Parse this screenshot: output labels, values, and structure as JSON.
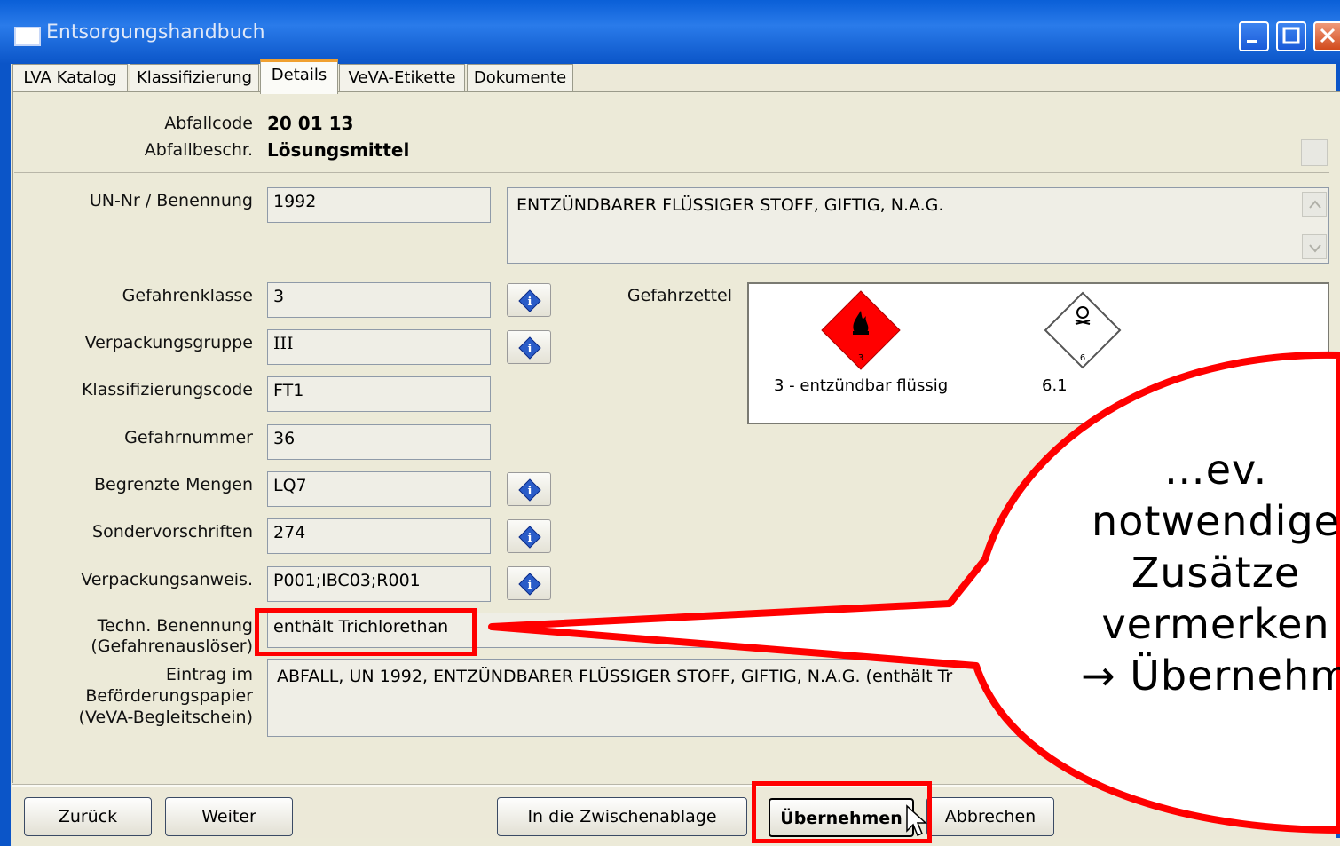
{
  "window": {
    "title": "Entsorgungshandbuch"
  },
  "tabs": [
    "LVA Katalog",
    "Klassifizierung",
    "Details",
    "VeVA-Etikette",
    "Dokumente"
  ],
  "active_tab": "Details",
  "header": {
    "abfallcode_label": "Abfallcode",
    "abfallcode_value": "20 01 13",
    "abfallbeschr_label": "Abfallbeschr.",
    "abfallbeschr_value": "Lösungsmittel"
  },
  "fields": {
    "un_label": "UN-Nr / Benennung",
    "un_nr": "1992",
    "benennung": "ENTZÜNDBARER FLÜSSIGER STOFF, GIFTIG, N.A.G.",
    "gefahrenklasse_label": "Gefahrenklasse",
    "gefahrenklasse": "3",
    "verpackungsgruppe_label": "Verpackungsgruppe",
    "verpackungsgruppe": "III",
    "klassifizierungscode_label": "Klassifizierungscode",
    "klassifizierungscode": "FT1",
    "gefahrnummer_label": "Gefahrnummer",
    "gefahrnummer": "36",
    "begrenzte_mengen_label": "Begrenzte Mengen",
    "begrenzte_mengen": "LQ7",
    "sondervorschriften_label": "Sondervorschriften",
    "sondervorschriften": "274",
    "verpackungsanweis_label": "Verpackungsanweis.",
    "verpackungsanweis": "P001;IBC03;R001",
    "techn_label_1": "Techn. Benennung",
    "techn_label_2": "(Gefahrenauslöser)",
    "techn_benennung": "enthält Trichlorethan",
    "eintrag_label_1": "Eintrag im",
    "eintrag_label_2": "Beförderungspapier",
    "eintrag_label_3": "(VeVA-Begleitschein)",
    "eintrag": "ABFALL, UN 1992, ENTZÜNDBARER FLÜSSIGER STOFF, GIFTIG, N.A.G. (enthält Tr"
  },
  "gefahrzettel": {
    "label": "Gefahrzettel",
    "items": [
      {
        "caption": "3 - entzündbar flüssig",
        "number": "3",
        "color": "#ff0000"
      },
      {
        "caption": "6.1",
        "number": "6",
        "color": "#ffffff"
      }
    ]
  },
  "buttons": {
    "zurueck": "Zurück",
    "weiter": "Weiter",
    "zwischenablage": "In die Zwischenablage",
    "uebernehmen": "Übernehmen",
    "abbrechen": "Abbrechen"
  },
  "callout": {
    "lines": [
      "…ev.",
      "notwendige",
      "Zusätze",
      "vermerken",
      "→ Übernehm"
    ],
    "color": "#ff0000"
  }
}
